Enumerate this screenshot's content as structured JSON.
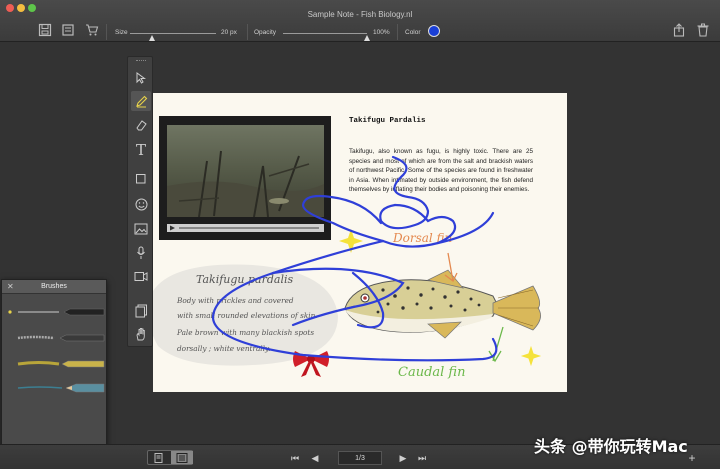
{
  "window": {
    "title": "Sample Note - Fish Biology.nl"
  },
  "toolbar": {
    "size_label": "Size",
    "size_value": "20 px",
    "size_level": 0.25,
    "opacity_label": "Opacity",
    "opacity_value": "100%",
    "opacity_level": 1.0,
    "color_label": "Color",
    "color_value": "#1a3fd6"
  },
  "tools": [
    "select-icon",
    "pencil-icon",
    "eraser-icon",
    "text-icon",
    "shape-icon",
    "emoji-icon",
    "image-icon",
    "microphone-icon",
    "video-icon",
    "pages-icon",
    "hand-icon"
  ],
  "page": {
    "heading": "Takifugu  Pardalis",
    "paragraph": "Takifugu, also known as fugu, is highly toxic. There are 25 species and most of which are from the salt and brackish waters of northwest Pacific. Some of the species are found in freshwater in Asia. When intimated by outside environment, the fish defend themselves by inflating their bodies and poisoning their enemies.",
    "note_title": "Takifugu pardalis",
    "note_lines": [
      "Body with prickles and covered",
      "with small rounded elevations of skin.",
      "Pale brown with many blackish spots",
      "dorsally ; white ventrally."
    ],
    "dorsal_label": "Dorsal fin",
    "caudal_label": "Caudal fin"
  },
  "brushes": {
    "title": "Brushes"
  },
  "pager": {
    "current": "1/3"
  },
  "watermark": "头条 @带你玩转Mac"
}
